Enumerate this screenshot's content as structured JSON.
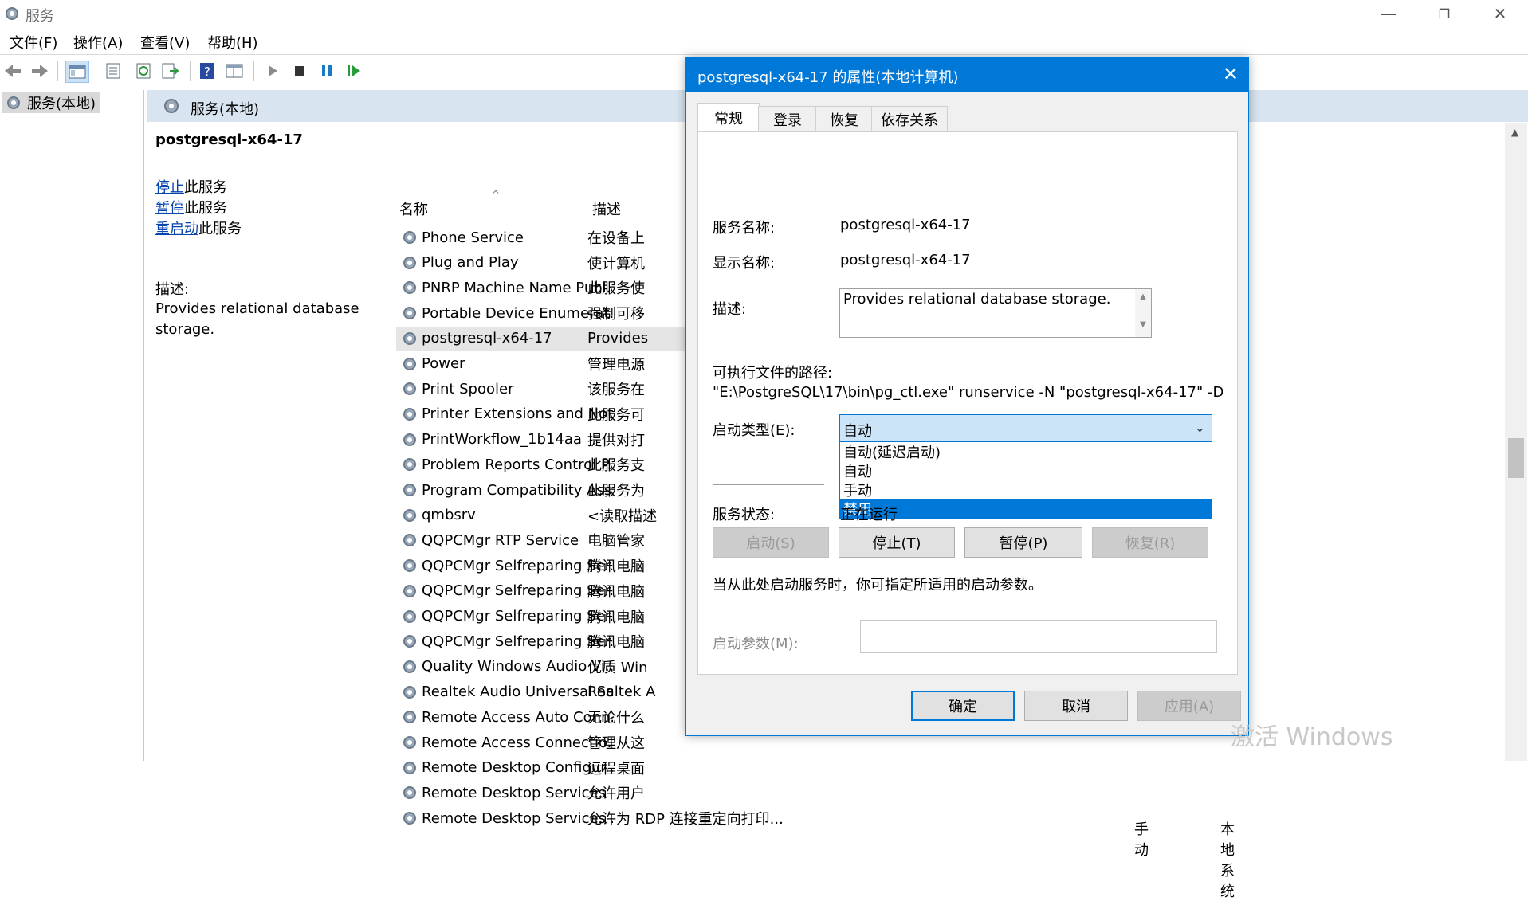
{
  "window": {
    "title": "服务",
    "minimize": "—",
    "restore": "❐",
    "close": "✕"
  },
  "menu": [
    "文件(F)",
    "操作(A)",
    "查看(V)",
    "帮助(H)"
  ],
  "tree": {
    "root": "服务(本地)"
  },
  "panel": {
    "header": "服务(本地)",
    "service_name": "postgresql-x64-17",
    "actions": [
      {
        "link": "停止",
        "suffix": "此服务"
      },
      {
        "link": "暂停",
        "suffix": "此服务"
      },
      {
        "link": "重启动",
        "suffix": "此服务"
      }
    ],
    "desc_label": "描述:",
    "desc_text": "Provides relational database storage."
  },
  "list": {
    "col_name": "名称",
    "col_desc": "描述",
    "rows": [
      {
        "name": "Phone Service",
        "desc": "在设备上"
      },
      {
        "name": "Plug and Play",
        "desc": "使计算机"
      },
      {
        "name": "PNRP Machine Name Publ...",
        "desc": "此服务使"
      },
      {
        "name": "Portable Device Enumerat...",
        "desc": "强制可移"
      },
      {
        "name": "postgresql-x64-17",
        "desc": "Provides"
      },
      {
        "name": "Power",
        "desc": "管理电源"
      },
      {
        "name": "Print Spooler",
        "desc": "该服务在"
      },
      {
        "name": "Printer Extensions and Noti...",
        "desc": "此服务可"
      },
      {
        "name": "PrintWorkflow_1b14aa",
        "desc": "提供对打"
      },
      {
        "name": "Problem Reports Control P...",
        "desc": "此服务支"
      },
      {
        "name": "Program Compatibility Assi...",
        "desc": "此服务为"
      },
      {
        "name": "qmbsrv",
        "desc": "<读取描述"
      },
      {
        "name": "QQPCMgr RTP Service",
        "desc": "电脑管家"
      },
      {
        "name": "QQPCMgr Selfreparing Ser...",
        "desc": "腾讯电脑"
      },
      {
        "name": "QQPCMgr Selfreparing Ser...",
        "desc": "腾讯电脑"
      },
      {
        "name": "QQPCMgr Selfreparing Ser...",
        "desc": "腾讯电脑"
      },
      {
        "name": "QQPCMgr Selfreparing Ser...",
        "desc": "腾讯电脑"
      },
      {
        "name": "Quality Windows Audio Vi...",
        "desc": "优质 Win"
      },
      {
        "name": "Realtek Audio Universal Se...",
        "desc": "Realtek A"
      },
      {
        "name": "Remote Access Auto Conn...",
        "desc": "无论什么"
      },
      {
        "name": "Remote Access Connectio...",
        "desc": "管理从这"
      },
      {
        "name": "Remote Desktop Configur...",
        "desc": "远程桌面"
      },
      {
        "name": "Remote Desktop Services",
        "desc": "允许用户"
      },
      {
        "name": "Remote Desktop Services ...",
        "desc": "允许为 RDP 连接重定向打印..."
      }
    ],
    "last_row_startup": "手动",
    "last_row_logon": "本地系统",
    "selected_index": 4
  },
  "dialog": {
    "title": "postgresql-x64-17 的属性(本地计算机)",
    "close": "✕",
    "tabs": [
      "常规",
      "登录",
      "恢复",
      "依存关系"
    ],
    "service_name_label": "服务名称:",
    "service_name_value": "postgresql-x64-17",
    "display_name_label": "显示名称:",
    "display_name_value": "postgresql-x64-17",
    "desc_label": "描述:",
    "desc_value": "Provides relational database storage.",
    "path_label": "可执行文件的路径:",
    "path_value": "\"E:\\PostgreSQL\\17\\bin\\pg_ctl.exe\" runservice -N \"postgresql-x64-17\" -D \"E:\\",
    "startup_label": "启动类型(E):",
    "startup_value": "自动",
    "startup_options": [
      "自动(延迟启动)",
      "自动",
      "手动",
      "禁用"
    ],
    "startup_highlighted": 3,
    "status_label": "服务状态:",
    "status_value": "正在运行",
    "btn_start": "启动(S)",
    "btn_stop": "停止(T)",
    "btn_pause": "暂停(P)",
    "btn_resume": "恢复(R)",
    "hint": "当从此处启动服务时，你可指定所适用的启动参数。",
    "param_label": "启动参数(M):",
    "param_value": "",
    "ok": "确定",
    "cancel": "取消",
    "apply": "应用(A)"
  },
  "watermark": "激活 Windows"
}
